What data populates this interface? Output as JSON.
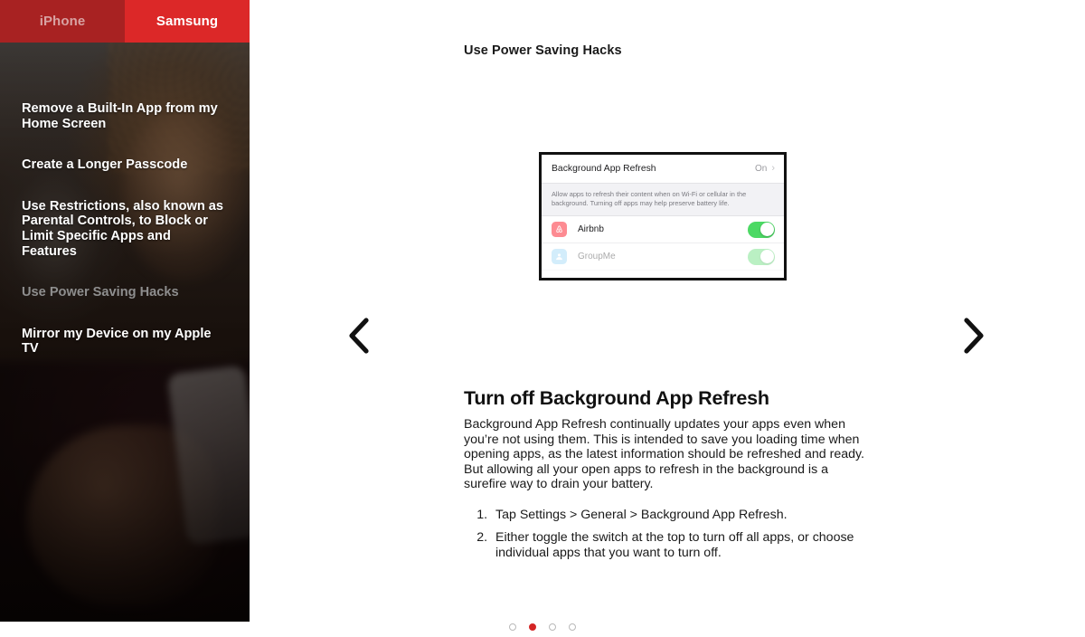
{
  "sidebar": {
    "tabs": [
      {
        "label": "iPhone",
        "active": false
      },
      {
        "label": "Samsung",
        "active": true
      }
    ],
    "items": [
      {
        "label": "Remove a Built-In App from my Home Screen",
        "current": false
      },
      {
        "label": "Create a Longer Passcode",
        "current": false
      },
      {
        "label": "Use Restrictions, also known as Parental Controls, to Block or Limit Specific Apps and Features",
        "current": false
      },
      {
        "label": "Use Power Saving Hacks",
        "current": true
      },
      {
        "label": "Mirror my Device on my Apple TV",
        "current": false
      }
    ]
  },
  "content": {
    "page_title": "Use Power Saving Hacks",
    "screenshot": {
      "header_title": "Background App Refresh",
      "header_value": "On",
      "chevron": "›",
      "description": "Allow apps to refresh their content when on Wi-Fi or cellular in the background. Turning off apps may help preserve battery life.",
      "rows": [
        {
          "app": "Airbnb",
          "toggle": "on",
          "icon": "airbnb-icon"
        },
        {
          "app": "GroupMe",
          "toggle": "on",
          "icon": "groupme-icon"
        }
      ]
    },
    "article": {
      "heading": "Turn off Background App Refresh",
      "paragraph": "Background App Refresh continually updates your apps even when you’re not using them. This is intended to save you loading time when opening apps, as the latest information should be refreshed and ready. But allowing all your open apps to refresh in the background is a surefire way to drain your battery.",
      "steps": [
        "Tap Settings > General > Background App Refresh.",
        "Either toggle the switch at the top to turn off all apps, or choose individual apps that you want to turn off."
      ]
    },
    "nav": {
      "prev_label": "‹",
      "next_label": "›"
    },
    "pagination": {
      "count": 4,
      "active_index": 1
    }
  },
  "colors": {
    "tab_active": "#dc2828",
    "tab_inactive": "#a82222",
    "dot_active": "#d42424",
    "toggle_on": "#4cd964"
  }
}
